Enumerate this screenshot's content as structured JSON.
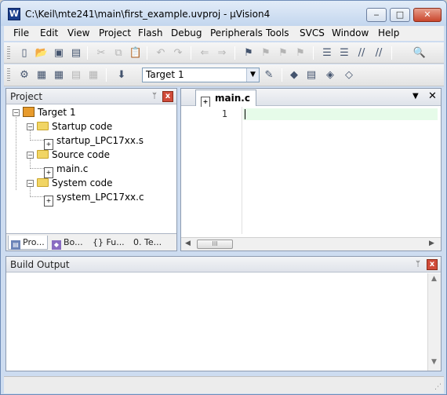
{
  "window": {
    "title": "C:\\Keil\\mte241\\main\\first_example.uvproj - µVision4",
    "app_icon_letter": "W",
    "minimize_glyph": "‒",
    "maximize_glyph": "□",
    "close_glyph": "✕"
  },
  "menu": [
    "File",
    "Edit",
    "View",
    "Project",
    "Flash",
    "Debug",
    "Peripherals",
    "Tools",
    "SVCS",
    "Window",
    "Help"
  ],
  "toolbar1_icons": [
    "new-file",
    "open",
    "save",
    "save-all",
    "cut",
    "copy",
    "paste",
    "undo",
    "redo",
    "nav-back",
    "nav-forward",
    "bookmark-set",
    "bookmark-prev",
    "bookmark-next",
    "bookmark-clear",
    "indent",
    "unindent",
    "comment",
    "uncomment",
    "find-in-files"
  ],
  "toolbar2_icons": [
    "translate",
    "build",
    "rebuild",
    "batch-build",
    "stop-build",
    "download",
    "target-options",
    "manage-components",
    "select-packs",
    "pack-installer",
    "file-extensions"
  ],
  "target": {
    "selected": "Target 1"
  },
  "project_pane": {
    "title": "Project",
    "pin_glyph": "ᛘ",
    "close_glyph": "x",
    "tree": {
      "root": "Target 1",
      "groups": [
        {
          "name": "Startup code",
          "files": [
            "startup_LPC17xx.s"
          ]
        },
        {
          "name": "Source code",
          "files": [
            "main.c"
          ]
        },
        {
          "name": "System code",
          "files": [
            "system_LPC17xx.c"
          ]
        }
      ]
    },
    "tabs": [
      "Pro...",
      "Bo...",
      "{} Fu...",
      "0. Te..."
    ]
  },
  "editor": {
    "tab_label": "main.c",
    "tab_menu_glyph": "▼",
    "tab_close_glyph": "✕",
    "line_numbers": [
      "1"
    ],
    "scroll_thumb_glyph": "III"
  },
  "build_output": {
    "title": "Build Output",
    "pin_glyph": "ᛘ",
    "close_glyph": "x"
  },
  "colors": {
    "current_line": "#e6fbe9",
    "folder": "#f1d564",
    "close_red": "#d04b3a"
  }
}
